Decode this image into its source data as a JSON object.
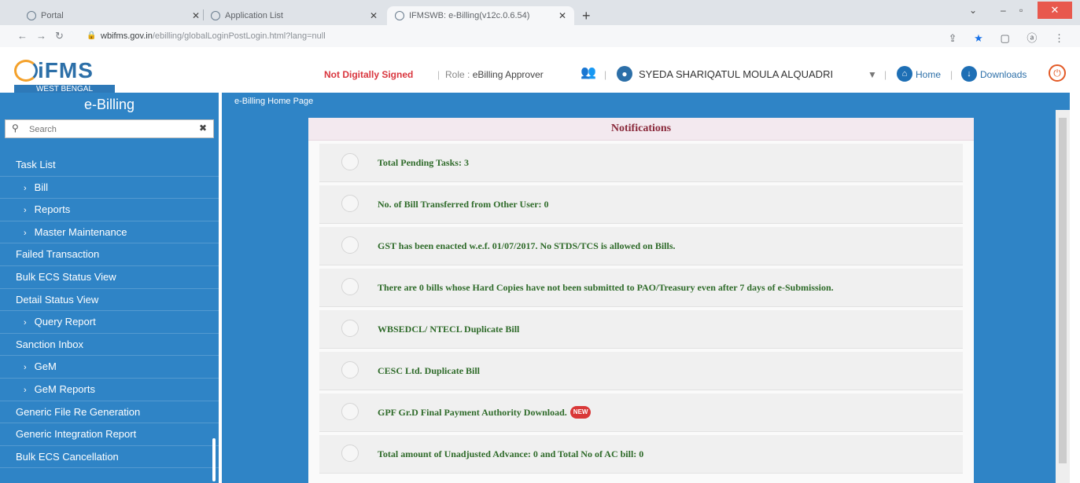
{
  "browser": {
    "tabs": [
      {
        "label": "Portal"
      },
      {
        "label": "Application List"
      },
      {
        "label": "IFMSWB: e-Billing(v12c.0.6.54)"
      }
    ],
    "url_host": "wbifms.gov.in",
    "url_path": "/ebilling/globalLoginPostLogin.html?lang=null"
  },
  "header": {
    "logo_title": "iFMS",
    "logo_subtitle": "WEST BENGAL",
    "signature_status": "Not Digitally Signed",
    "role_label": "Role :",
    "role_value": "eBilling Approver",
    "username": "SYEDA SHARIQATUL MOULA ALQUADRI",
    "home_label": "Home",
    "downloads_label": "Downloads"
  },
  "sidebar": {
    "title": "e-Billing",
    "search_placeholder": "Search",
    "items": [
      {
        "label": "Task List",
        "sub": false
      },
      {
        "label": "Bill",
        "sub": true
      },
      {
        "label": "Reports",
        "sub": true
      },
      {
        "label": "Master Maintenance",
        "sub": true
      },
      {
        "label": "Failed Transaction",
        "sub": false
      },
      {
        "label": "Bulk ECS Status View",
        "sub": false
      },
      {
        "label": "Detail Status View",
        "sub": false
      },
      {
        "label": "Query Report",
        "sub": true
      },
      {
        "label": "Sanction Inbox",
        "sub": false
      },
      {
        "label": "GeM",
        "sub": true
      },
      {
        "label": "GeM Reports",
        "sub": true
      },
      {
        "label": "Generic File Re Generation",
        "sub": false
      },
      {
        "label": "Generic Integration Report",
        "sub": false
      },
      {
        "label": "Bulk ECS Cancellation",
        "sub": false
      }
    ]
  },
  "main": {
    "breadcrumb": "e-Billing Home Page",
    "panel_title": "Notifications",
    "notifications": [
      {
        "text": "Total Pending Tasks: 3"
      },
      {
        "text": "No. of Bill Transferred from Other User: 0"
      },
      {
        "text": "GST has been enacted w.e.f. 01/07/2017. No STDS/TCS is allowed on Bills."
      },
      {
        "text": "There are 0 bills whose Hard Copies have not been submitted to PAO/Treasury even after 7 days of e-Submission."
      },
      {
        "text": "WBSEDCL/ NTECL Duplicate Bill"
      },
      {
        "text": "CESC Ltd. Duplicate Bill"
      },
      {
        "text": "GPF Gr.D Final Payment Authority Download.",
        "badge": "NEW"
      },
      {
        "text": "Total amount of Unadjusted Advance: 0 and Total No of AC bill: 0"
      }
    ]
  },
  "colors": {
    "sidebar_blue": "#2f84c6",
    "notif_green": "#2f6b2a",
    "notif_title": "#8a2a3b",
    "alert_red": "#d9363e"
  }
}
